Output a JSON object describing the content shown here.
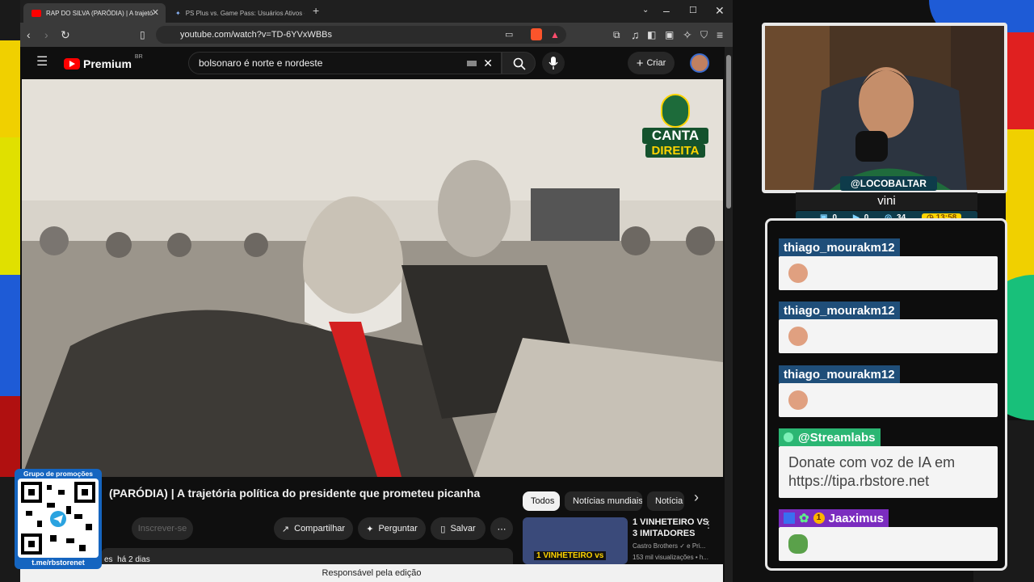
{
  "browser": {
    "tabs": [
      {
        "label": "RAP DO SILVA (PARÓDIA) | A trajetó"
      },
      {
        "label": "PS Plus vs. Game Pass: Usuários Ativos - Goo"
      }
    ],
    "url": "youtube.com/watch?v=TD-6YVxWBBs",
    "shield_count": "99+"
  },
  "youtube": {
    "logo": "Premium",
    "region": "BR",
    "search_value": "bolsonaro é norte e nordeste",
    "create_label": "Criar",
    "video_title": "(PARÓDIA) | A trajetória política do presidente que prometeu picanha",
    "subscribe_label": "Inscrever-se",
    "share_label": "Compartilhar",
    "ask_label": "Perguntar",
    "save_label": "Salvar",
    "views_age": "es  há 2 dias",
    "chips": [
      "Todos",
      "Notícias mundiais",
      "Notícia"
    ],
    "rec": {
      "title_line1": "1 VINHETEIRO VS",
      "title_line2": "3 IMITADORES",
      "channel": "Castro Brothers ✓ e Pri...",
      "meta": "153 mil visualizações • h...",
      "thumb_text": "1 VINHETEIRO vs"
    },
    "bottom_text": "Responsável pela edição",
    "overlay_logo": [
      "CANTA",
      "DIREITA"
    ]
  },
  "promo": {
    "title": "Grupo de promoções",
    "link": "t.me/rbstorenet"
  },
  "stream": {
    "handle": "@LOCOBALTAR",
    "name": "vini",
    "stats": [
      "0",
      "0",
      "34"
    ],
    "timer": "13:58"
  },
  "chat": {
    "messages": [
      {
        "user": "thiago_mourakm12"
      },
      {
        "user": "thiago_mourakm12"
      },
      {
        "user": "thiago_mourakm12"
      }
    ],
    "streamlabs_user": "@Streamlabs",
    "streamlabs_text": "Donate com voz de IA em https://tipa.rbstore.net",
    "last_user": "Jaaximus",
    "last_badge": "1"
  },
  "colors": {
    "yt_red": "#ff0000",
    "chat_user_bg": "#1f4e79",
    "streamlabs_green": "#2bb673",
    "jaax_purple": "#7b2cbf"
  }
}
